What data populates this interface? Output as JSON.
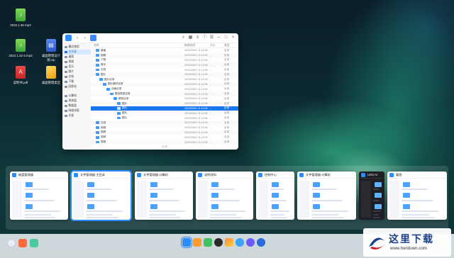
{
  "desktop": {
    "icons": [
      {
        "label": "2022.1.30.mp3",
        "kind": "audio",
        "glyph": "♪"
      },
      {
        "label": "2022.1.22-2.mp3",
        "kind": "audio",
        "glyph": "♪"
      },
      {
        "label": "桌面管理设计图.zip",
        "kind": "zip",
        "glyph": "▤"
      },
      {
        "label": "说明书.pdf",
        "kind": "pdf",
        "glyph": "A"
      },
      {
        "label": "桌面管理类型",
        "kind": "folder",
        "glyph": ""
      }
    ]
  },
  "file_manager": {
    "sidebar": [
      "最近使用",
      "主目录",
      "桌面",
      "视频",
      "音乐",
      "图片",
      "文档",
      "下载",
      "回收站",
      "计算机",
      "系统盘",
      "数据盘",
      "网络邻居",
      "光驱"
    ],
    "sidebar_active": 1,
    "columns": {
      "name": "名称",
      "date": "修改时间",
      "size": "大小",
      "type": "类型"
    },
    "rows": [
      {
        "name": "桌面",
        "date": "2022/03/01 11:10:50",
        "size": "-",
        "type": "目录"
      },
      {
        "name": "视频",
        "date": "2022/03/01 11:10:50",
        "size": "-",
        "type": "目录"
      },
      {
        "name": "下载",
        "date": "2022/03/01 11:10:50",
        "size": "-",
        "type": "目录"
      },
      {
        "name": "音乐",
        "date": "2022/03/01 11:10:50",
        "size": "-",
        "type": "目录"
      },
      {
        "name": "文档",
        "date": "2022/03/01 11:10:50",
        "size": "-",
        "type": "目录"
      },
      {
        "name": "图片",
        "date": "2022/03/01 11:10:50",
        "size": "-",
        "type": "目录"
      },
      {
        "name": "图片目录",
        "date": "2022/03/01 11:10:50",
        "size": "-",
        "type": "目录"
      },
      {
        "name": "图片素材目录",
        "date": "2022/03/01 11:10:50",
        "size": "-",
        "type": "目录"
      },
      {
        "name": "动画目录",
        "date": "2022/03/01 11:10:50",
        "size": "-",
        "type": "目录"
      },
      {
        "name": "壁纸类型目录",
        "date": "2022/03/01 11:10:50",
        "size": "-",
        "type": "目录"
      },
      {
        "name": "图标目录",
        "date": "2022/03/01 11:10:50",
        "size": "-",
        "type": "目录"
      },
      {
        "name": "图片",
        "date": "2022/03/01 11:10:50",
        "size": "-",
        "type": "目录"
      },
      {
        "name": "图片",
        "date": "2022/03/01 11:10:50",
        "size": "-",
        "type": "目录"
      },
      {
        "name": "图片",
        "date": "2022/03/01 11:10:50",
        "size": "-",
        "type": "目录"
      },
      {
        "name": "图片",
        "date": "2022/03/01 11:10:50",
        "size": "-",
        "type": "目录"
      },
      {
        "name": "文档",
        "date": "2022/03/01 11:10:50",
        "size": "-",
        "type": "目录"
      },
      {
        "name": "视频",
        "date": "2022/03/01 11:10:50",
        "size": "-",
        "type": "目录"
      },
      {
        "name": "视频",
        "date": "2022/03/01 11:10:50",
        "size": "-",
        "type": "目录"
      },
      {
        "name": "视频",
        "date": "2022/03/01 11:10:50",
        "size": "-",
        "type": "目录"
      },
      {
        "name": "视频",
        "date": "2022/03/01 11:10:50",
        "size": "-",
        "type": "目录"
      }
    ],
    "selected_row": 12,
    "status": "20 项"
  },
  "switcher": {
    "windows": [
      {
        "title": "磁盘管理器",
        "dark": false
      },
      {
        "title": "文件管理器-主目录",
        "dark": false,
        "active": true
      },
      {
        "title": "文件管理器-计算机",
        "dark": false
      },
      {
        "title": "说明须知",
        "dark": false
      },
      {
        "title": "控制中心",
        "dark": false
      },
      {
        "title": "文件管理器-计算机",
        "dark": false
      },
      {
        "title": "UOS AI",
        "dark": true
      },
      {
        "title": "看图",
        "dark": false
      }
    ]
  },
  "watermark": {
    "title": "这里下载",
    "url": "www.herdown.com"
  },
  "colors": {
    "accent": "#2a8cff",
    "selection": "#1a77ee"
  }
}
